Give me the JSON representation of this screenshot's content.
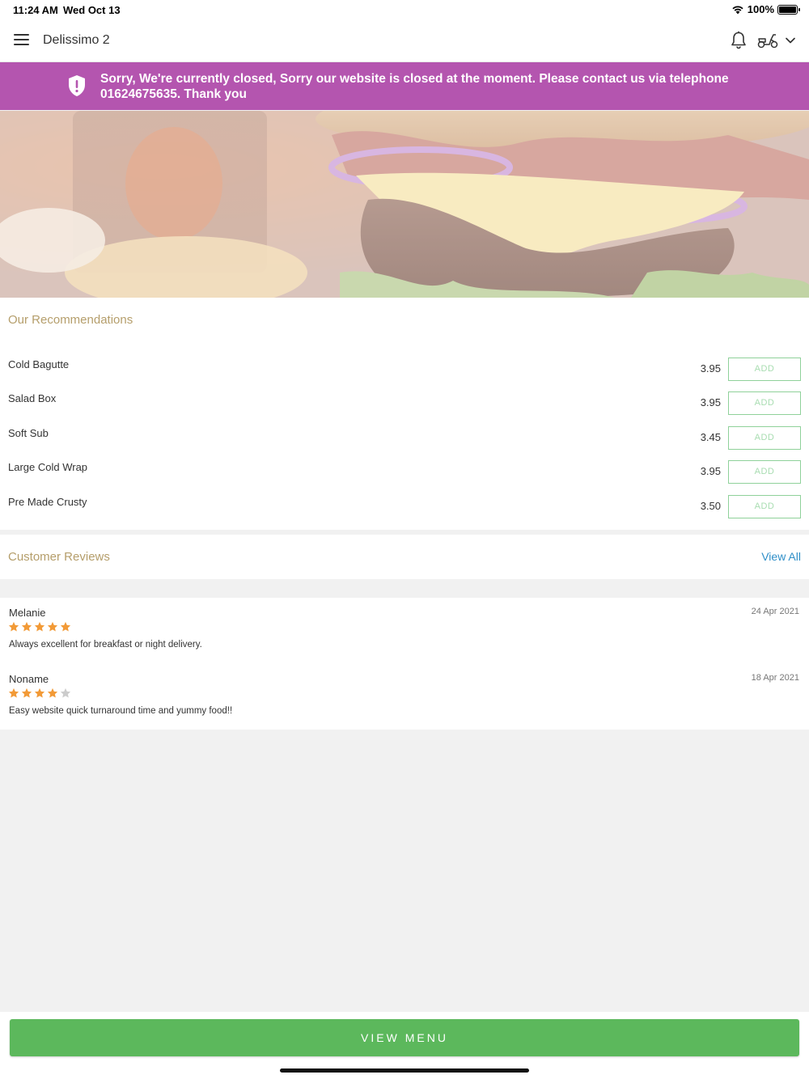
{
  "status_bar": {
    "time": "11:24 AM",
    "date": "Wed Oct 13",
    "battery": "100%",
    "battery_level": 1.0,
    "icons": [
      "wifi-icon",
      "battery-icon"
    ]
  },
  "header": {
    "title": "Delissimo 2",
    "icons": [
      "menu-icon",
      "bell-icon",
      "scooter-icon",
      "chevron-down-icon"
    ]
  },
  "banner": {
    "message": "Sorry, We're currently closed, Sorry our website is closed at the moment. Please contact us via telephone 01624675635. Thank you",
    "color": "#b455af",
    "icon": "shield-alert-icon"
  },
  "recommendations": {
    "title": "Our Recommendations",
    "add_label": "ADD",
    "items": [
      {
        "name": "Cold Bagutte",
        "price": "3.95"
      },
      {
        "name": "Salad Box",
        "price": "3.95"
      },
      {
        "name": "Soft Sub",
        "price": "3.45"
      },
      {
        "name": "Large Cold Wrap",
        "price": "3.95"
      },
      {
        "name": "Pre Made Crusty",
        "price": "3.50"
      }
    ]
  },
  "reviews": {
    "title": "Customer Reviews",
    "view_all": "View All",
    "items": [
      {
        "name": "Melanie",
        "date": "24 Apr 2021",
        "rating": 5,
        "text": "Always excellent for breakfast or night delivery."
      },
      {
        "name": "Noname",
        "date": "18 Apr 2021",
        "rating": 4,
        "text": "Easy website quick turnaround time and yummy food!!"
      }
    ]
  },
  "footer": {
    "view_menu": "VIEW MENU",
    "color": "#5cb85c"
  },
  "colors": {
    "section_title": "#b59e6b",
    "link": "#2f8fc8",
    "star": "#f29a37",
    "star_empty": "#cccccc"
  }
}
